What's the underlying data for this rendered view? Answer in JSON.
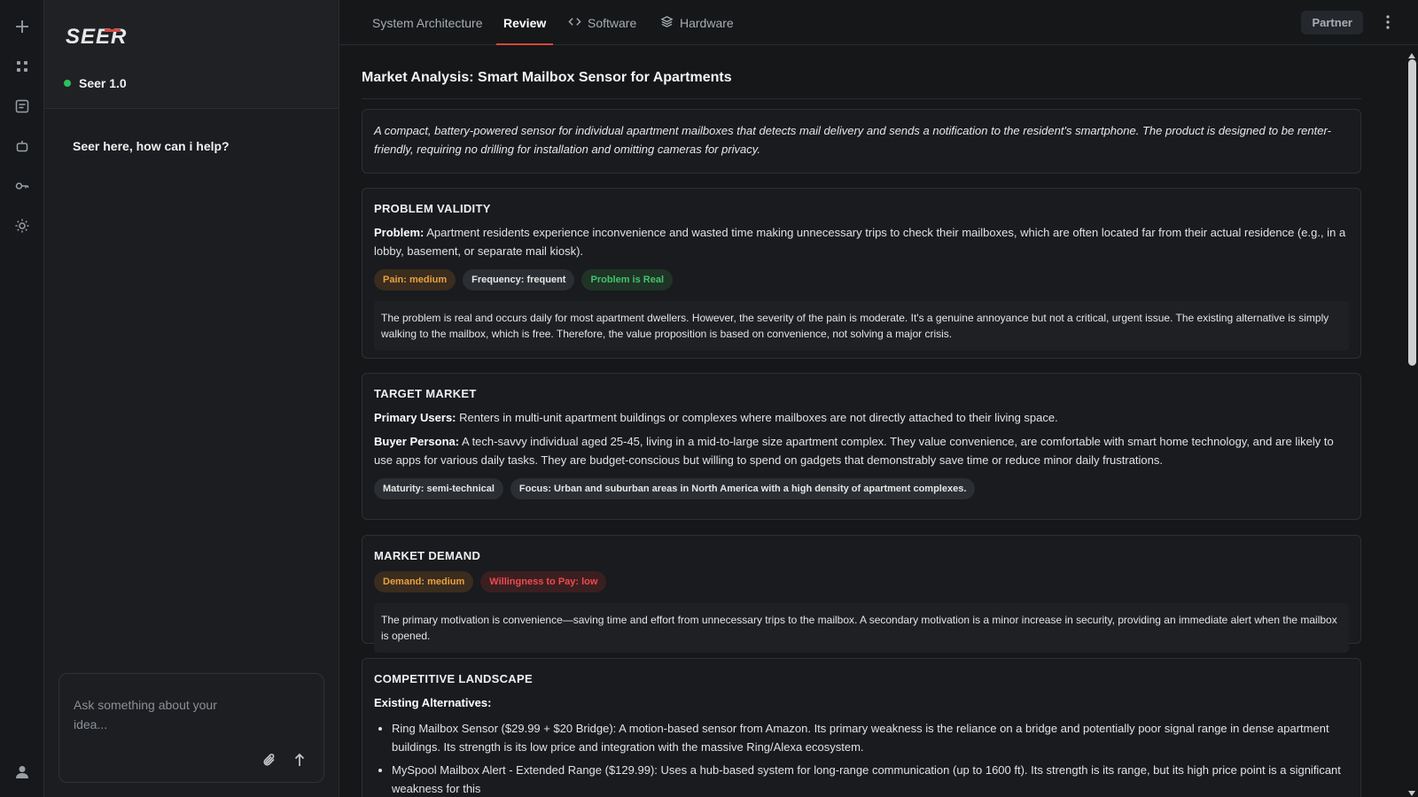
{
  "rail": {
    "icons": [
      "plus-icon",
      "grid-icon",
      "document-icon",
      "robot-icon",
      "key-icon",
      "sun-icon",
      "user-icon"
    ]
  },
  "chat": {
    "logo_text": "SEER",
    "model_name": "Seer 1.0",
    "model_status_color": "#2fbf5a",
    "greeting": "Seer here, how can i help?",
    "input_placeholder": "Ask something about your idea...",
    "input_value": ""
  },
  "tabs": [
    {
      "label": "System Architecture",
      "active": false
    },
    {
      "label": "Review",
      "active": true
    },
    {
      "label": "Software",
      "icon": "code-icon",
      "active": false
    },
    {
      "label": "Hardware",
      "icon": "layers-icon",
      "active": false
    }
  ],
  "header": {
    "partner_label": "Partner",
    "accent_color": "#d8463c"
  },
  "page": {
    "title": "Market Analysis: Smart Mailbox Sensor for Apartments",
    "summary": "A compact, battery-powered sensor for individual apartment mailboxes that detects mail delivery and sends a notification to the resident's smartphone. The product is designed to be renter-friendly, requiring no drilling for installation and omitting cameras for privacy."
  },
  "problem": {
    "heading": "PROBLEM VALIDITY",
    "label": "Problem:",
    "text": "Apartment residents experience inconvenience and wasted time making unnecessary trips to check their mailboxes, which are often located far from their actual residence (e.g., in a lobby, basement, or separate mail kiosk).",
    "pills": [
      "Pain: medium",
      "Frequency: frequent",
      "Problem is Real"
    ],
    "note": "The problem is real and occurs daily for most apartment dwellers. However, the severity of the pain is moderate. It's a genuine annoyance but not a critical, urgent issue. The existing alternative is simply walking to the mailbox, which is free. Therefore, the value proposition is based on convenience, not solving a major crisis."
  },
  "target": {
    "heading": "TARGET MARKET",
    "users_label": "Primary Users:",
    "users_text": "Renters in multi-unit apartment buildings or complexes where mailboxes are not directly attached to their living space.",
    "persona_label": "Buyer Persona:",
    "persona_text": "A tech-savvy individual aged 25-45, living in a mid-to-large size apartment complex. They value convenience, are comfortable with smart home technology, and are likely to use apps for various daily tasks. They are budget-conscious but willing to spend on gadgets that demonstrably save time or reduce minor daily frustrations.",
    "pills": [
      "Maturity: semi-technical",
      "Focus: Urban and suburban areas in North America with a high density of apartment complexes."
    ]
  },
  "demand": {
    "heading": "MARKET DEMAND",
    "pills": [
      "Demand: medium",
      "Willingness to Pay: low"
    ],
    "note": "The primary motivation is convenience—saving time and effort from unnecessary trips to the mailbox. A secondary motivation is a minor increase in security, providing an immediate alert when the mailbox is opened."
  },
  "competition": {
    "heading": "COMPETITIVE LANDSCAPE",
    "label": "Existing Alternatives:",
    "items": [
      "Ring Mailbox Sensor ($29.99 + $20 Bridge): A motion-based sensor from Amazon. Its primary weakness is the reliance on a bridge and potentially poor signal range in dense apartment buildings. Its strength is its low price and integration with the massive Ring/Alexa ecosystem.",
      "MySpool Mailbox Alert - Extended Range ($129.99): Uses a hub-based system for long-range communication (up to 1600 ft). Its strength is its range, but its high price point is a significant weakness for this"
    ]
  },
  "scrollbar": {
    "position_fraction": 0.0
  }
}
